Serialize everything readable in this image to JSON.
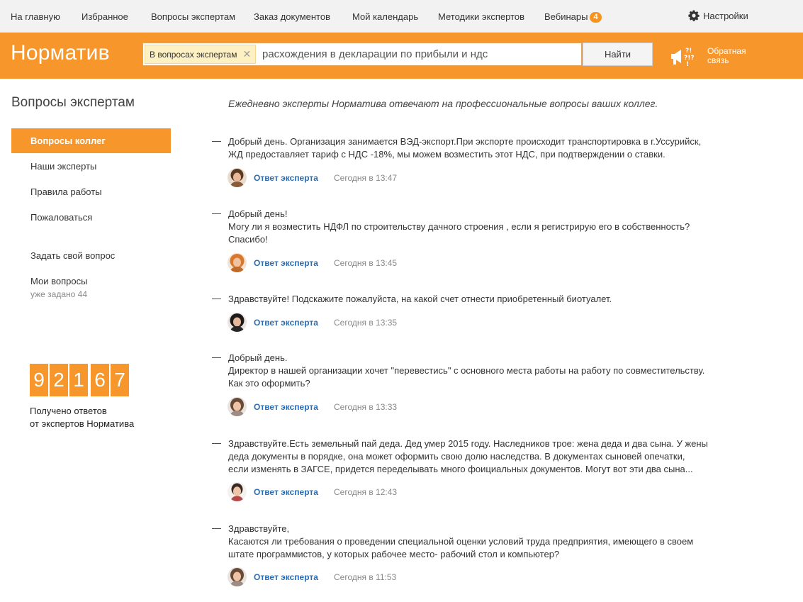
{
  "topnav": {
    "items": [
      "На главную",
      "Избранное",
      "Вопросы экспертам",
      "Заказ документов",
      "Мой календарь",
      "Методики экспертов",
      "Вебинары"
    ],
    "webinars_badge": "4",
    "settings_label": "Настройки"
  },
  "header": {
    "logo": "Норматив",
    "search_chip": "В вопросах экспертам",
    "search_value": "расхождения в декларации по прибыли и ндс",
    "find_button": "Найти",
    "feedback_line1": "Обратная",
    "feedback_line2": "связь"
  },
  "sidebar": {
    "title": "Вопросы экспертам",
    "items": [
      "Вопросы коллег",
      "Наши эксперты",
      "Правила работы",
      "Пожаловаться"
    ],
    "ask_question": "Задать свой вопрос",
    "my_questions": "Мои вопросы",
    "my_questions_sub": "уже задано 44",
    "counter_digits": [
      "9",
      "2",
      "1",
      "6",
      "7"
    ],
    "counter_caption_line1": "Получено ответов",
    "counter_caption_line2": "от экспертов Норматива"
  },
  "main": {
    "intro": "Ежедневно эксперты Норматива отвечают на профессиональные вопросы ваших коллег.",
    "dash": "—",
    "answer_label": "Ответ эксперта",
    "questions": [
      {
        "lines": [
          "Добрый день. Организация занимается ВЭД-экспорт.При экспорте происходит транспортировка в г.Уссурийск,",
          "ЖД предоставляет тариф с НДС -18%, мы можем возместить этот НДС, при подтверждении о ставки."
        ],
        "time": "Сегодня в 13:47"
      },
      {
        "lines": [
          "Добрый день!",
          "Могу ли я возместить НДФЛ по строительству дачного строения , если я регистрирую его в собственность?",
          "Спасибо!"
        ],
        "time": "Сегодня в 13:45"
      },
      {
        "lines": [
          "Здравствуйте! Подскажите пожалуйста, на какой счет отнести приобретенный биотуалет."
        ],
        "time": "Сегодня в 13:35"
      },
      {
        "lines": [
          "Добрый день.",
          "Директор в нашей организации хочет \"перевестись\" с основного места работы на работу по совместительству.",
          "Как это оформить?"
        ],
        "time": "Сегодня в 13:33"
      },
      {
        "lines": [
          "Здравствуйте.Есть земельный пай деда. Дед умер 2015 году. Наследников трое: жена деда и два сына. У жены",
          "деда документы в порядке, она может оформить свою долю наследства. В документах сыновей опечатки,",
          "если изменять в ЗАГСЕ, придется переделывать много фоициальных документов. Могут вот эти два сына..."
        ],
        "time": "Сегодня в 12:43"
      },
      {
        "lines": [
          "Здравствуйте,",
          "Касаются ли требования о проведении специальной оценки условий труда предприятия, имеющего в своем",
          "штате программистов, у которых рабочее место- рабочий стол и компьютер?"
        ],
        "time": "Сегодня в 11:53"
      }
    ]
  },
  "colors": {
    "accent": "#f7962b",
    "link": "#2a6db5",
    "nav_bg": "#f2f2f2"
  }
}
